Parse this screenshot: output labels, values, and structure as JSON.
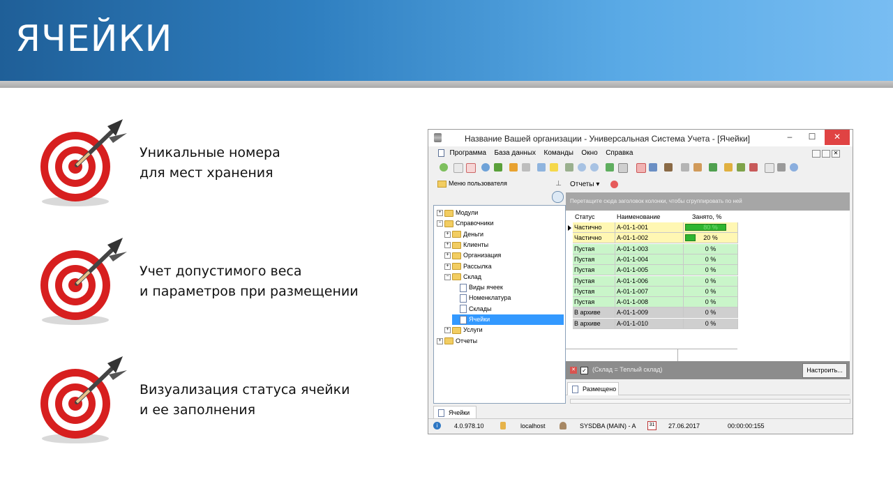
{
  "slide": {
    "title": "ЯЧЕЙКИ",
    "features": [
      {
        "line1": "Уникальные номера",
        "line2": "для мест хранения"
      },
      {
        "line1": "Учет допустимого веса",
        "line2": "и параметров при размещении"
      },
      {
        "line1": "Визуализация статуса ячейки",
        "line2": "и ее заполнения"
      }
    ]
  },
  "app": {
    "window_title": "Название Вашей организации - Универсальная Система Учета - [Ячейки]",
    "menu": [
      "Программа",
      "База данных",
      "Команды",
      "Окно",
      "Справка"
    ],
    "left_panel_title": "Меню пользователя",
    "tree": [
      {
        "label": "Модули",
        "level": 0,
        "type": "folder",
        "expander": "+"
      },
      {
        "label": "Справочники",
        "level": 0,
        "type": "folder",
        "expander": "−"
      },
      {
        "label": "Деньги",
        "level": 1,
        "type": "folder",
        "expander": "+"
      },
      {
        "label": "Клиенты",
        "level": 1,
        "type": "folder",
        "expander": "+"
      },
      {
        "label": "Организация",
        "level": 1,
        "type": "folder",
        "expander": "+"
      },
      {
        "label": "Рассылка",
        "level": 1,
        "type": "folder",
        "expander": "+"
      },
      {
        "label": "Склад",
        "level": 1,
        "type": "folder",
        "expander": "−"
      },
      {
        "label": "Виды ячеек",
        "level": 2,
        "type": "doc",
        "expander": ""
      },
      {
        "label": "Номенклатура",
        "level": 2,
        "type": "doc",
        "expander": ""
      },
      {
        "label": "Склады",
        "level": 2,
        "type": "doc",
        "expander": ""
      },
      {
        "label": "Ячейки",
        "level": 2,
        "type": "doc",
        "expander": "",
        "selected": true
      },
      {
        "label": "Услуги",
        "level": 1,
        "type": "folder",
        "expander": "+"
      },
      {
        "label": "Отчеты",
        "level": 0,
        "type": "folder",
        "expander": "+"
      }
    ],
    "reports_label": "Отчеты",
    "group_hint": "Перетащите сюда заголовок колонки, чтобы сгруппировать по ней",
    "columns": [
      "Статус",
      "Наименование",
      "Занято, %"
    ],
    "rows": [
      {
        "status": "Частично",
        "name": "A-01-1-001",
        "percent": 80,
        "label": "80 %",
        "kind": "partial"
      },
      {
        "status": "Частично",
        "name": "A-01-1-002",
        "percent": 20,
        "label": "20 %",
        "kind": "partial"
      },
      {
        "status": "Пустая",
        "name": "A-01-1-003",
        "percent": 0,
        "label": "0 %",
        "kind": "empty"
      },
      {
        "status": "Пустая",
        "name": "A-01-1-004",
        "percent": 0,
        "label": "0 %",
        "kind": "empty"
      },
      {
        "status": "Пустая",
        "name": "A-01-1-005",
        "percent": 0,
        "label": "0 %",
        "kind": "empty"
      },
      {
        "status": "Пустая",
        "name": "A-01-1-006",
        "percent": 0,
        "label": "0 %",
        "kind": "empty"
      },
      {
        "status": "Пустая",
        "name": "A-01-1-007",
        "percent": 0,
        "label": "0 %",
        "kind": "empty"
      },
      {
        "status": "Пустая",
        "name": "A-01-1-008",
        "percent": 0,
        "label": "0 %",
        "kind": "empty"
      },
      {
        "status": "В архиве",
        "name": "A-01-1-009",
        "percent": 0,
        "label": "0 %",
        "kind": "archive"
      },
      {
        "status": "В архиве",
        "name": "A-01-1-010",
        "percent": 0,
        "label": "0 %",
        "kind": "archive"
      }
    ],
    "filter_text": "(Склад = Теплый склад)",
    "configure_button": "Настроить...",
    "bottom_tab": "Размещено",
    "doc_tab": "Ячейки",
    "statusbar": {
      "version": "4.0.978.10",
      "server": "localhost",
      "user": "SYSDBA (MAIN) - A",
      "calendar_day": "31",
      "date": "27.06.2017",
      "time": "00:00:00:155"
    },
    "colors": {
      "partial": "#fff7b3",
      "empty": "#c9f5c9",
      "archive": "#cfcfcf",
      "bar": "#2fb52f"
    }
  }
}
